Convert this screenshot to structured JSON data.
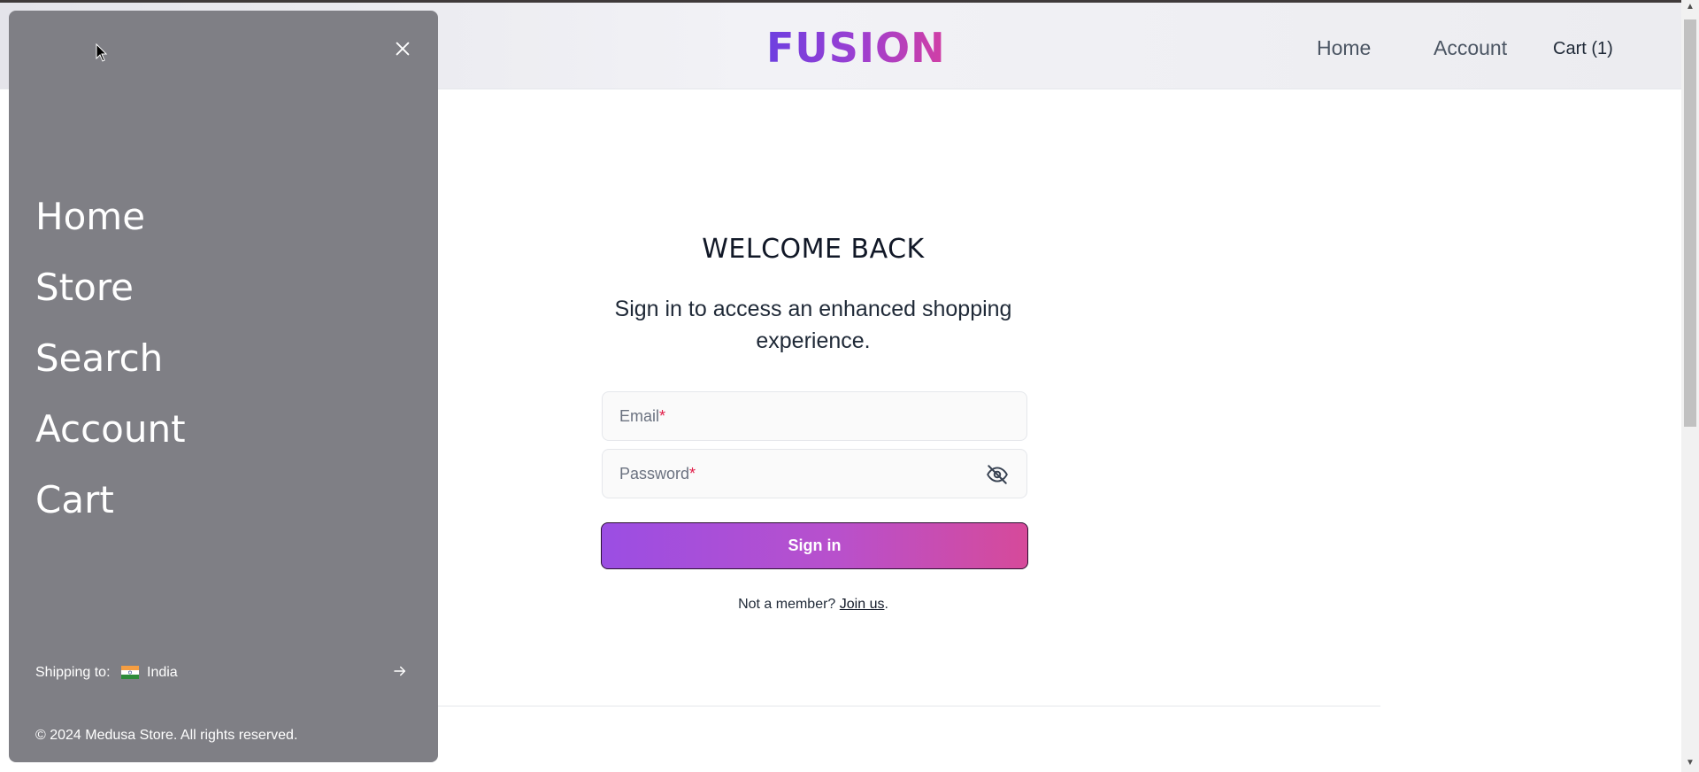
{
  "header": {
    "logo": "FUSION",
    "nav": {
      "home": "Home",
      "account": "Account",
      "cart": "Cart (1)"
    }
  },
  "login": {
    "title": "WELCOME BACK",
    "subtitle": "Sign in to access an enhanced shopping experience.",
    "email_label": "Email",
    "password_label": "Password",
    "required_mark": "*",
    "sign_in_label": "Sign in",
    "not_member": "Not a member?",
    "join_label": "Join us",
    "join_suffix": "."
  },
  "drawer": {
    "menu_items": [
      "Home",
      "Store",
      "Search",
      "Account",
      "Cart"
    ],
    "shipping_label": "Shipping to:",
    "country": "India",
    "copyright": "© 2024 Medusa Store. All rights reserved."
  },
  "icons": {
    "close": "close-icon",
    "eye_off": "eye-off-icon",
    "flag": "india-flag-icon",
    "arrow": "arrow-right-icon"
  },
  "colors": {
    "brand_start": "#6d3fe0",
    "brand_end": "#d23fa4",
    "drawer_bg": "#7f7f85"
  }
}
